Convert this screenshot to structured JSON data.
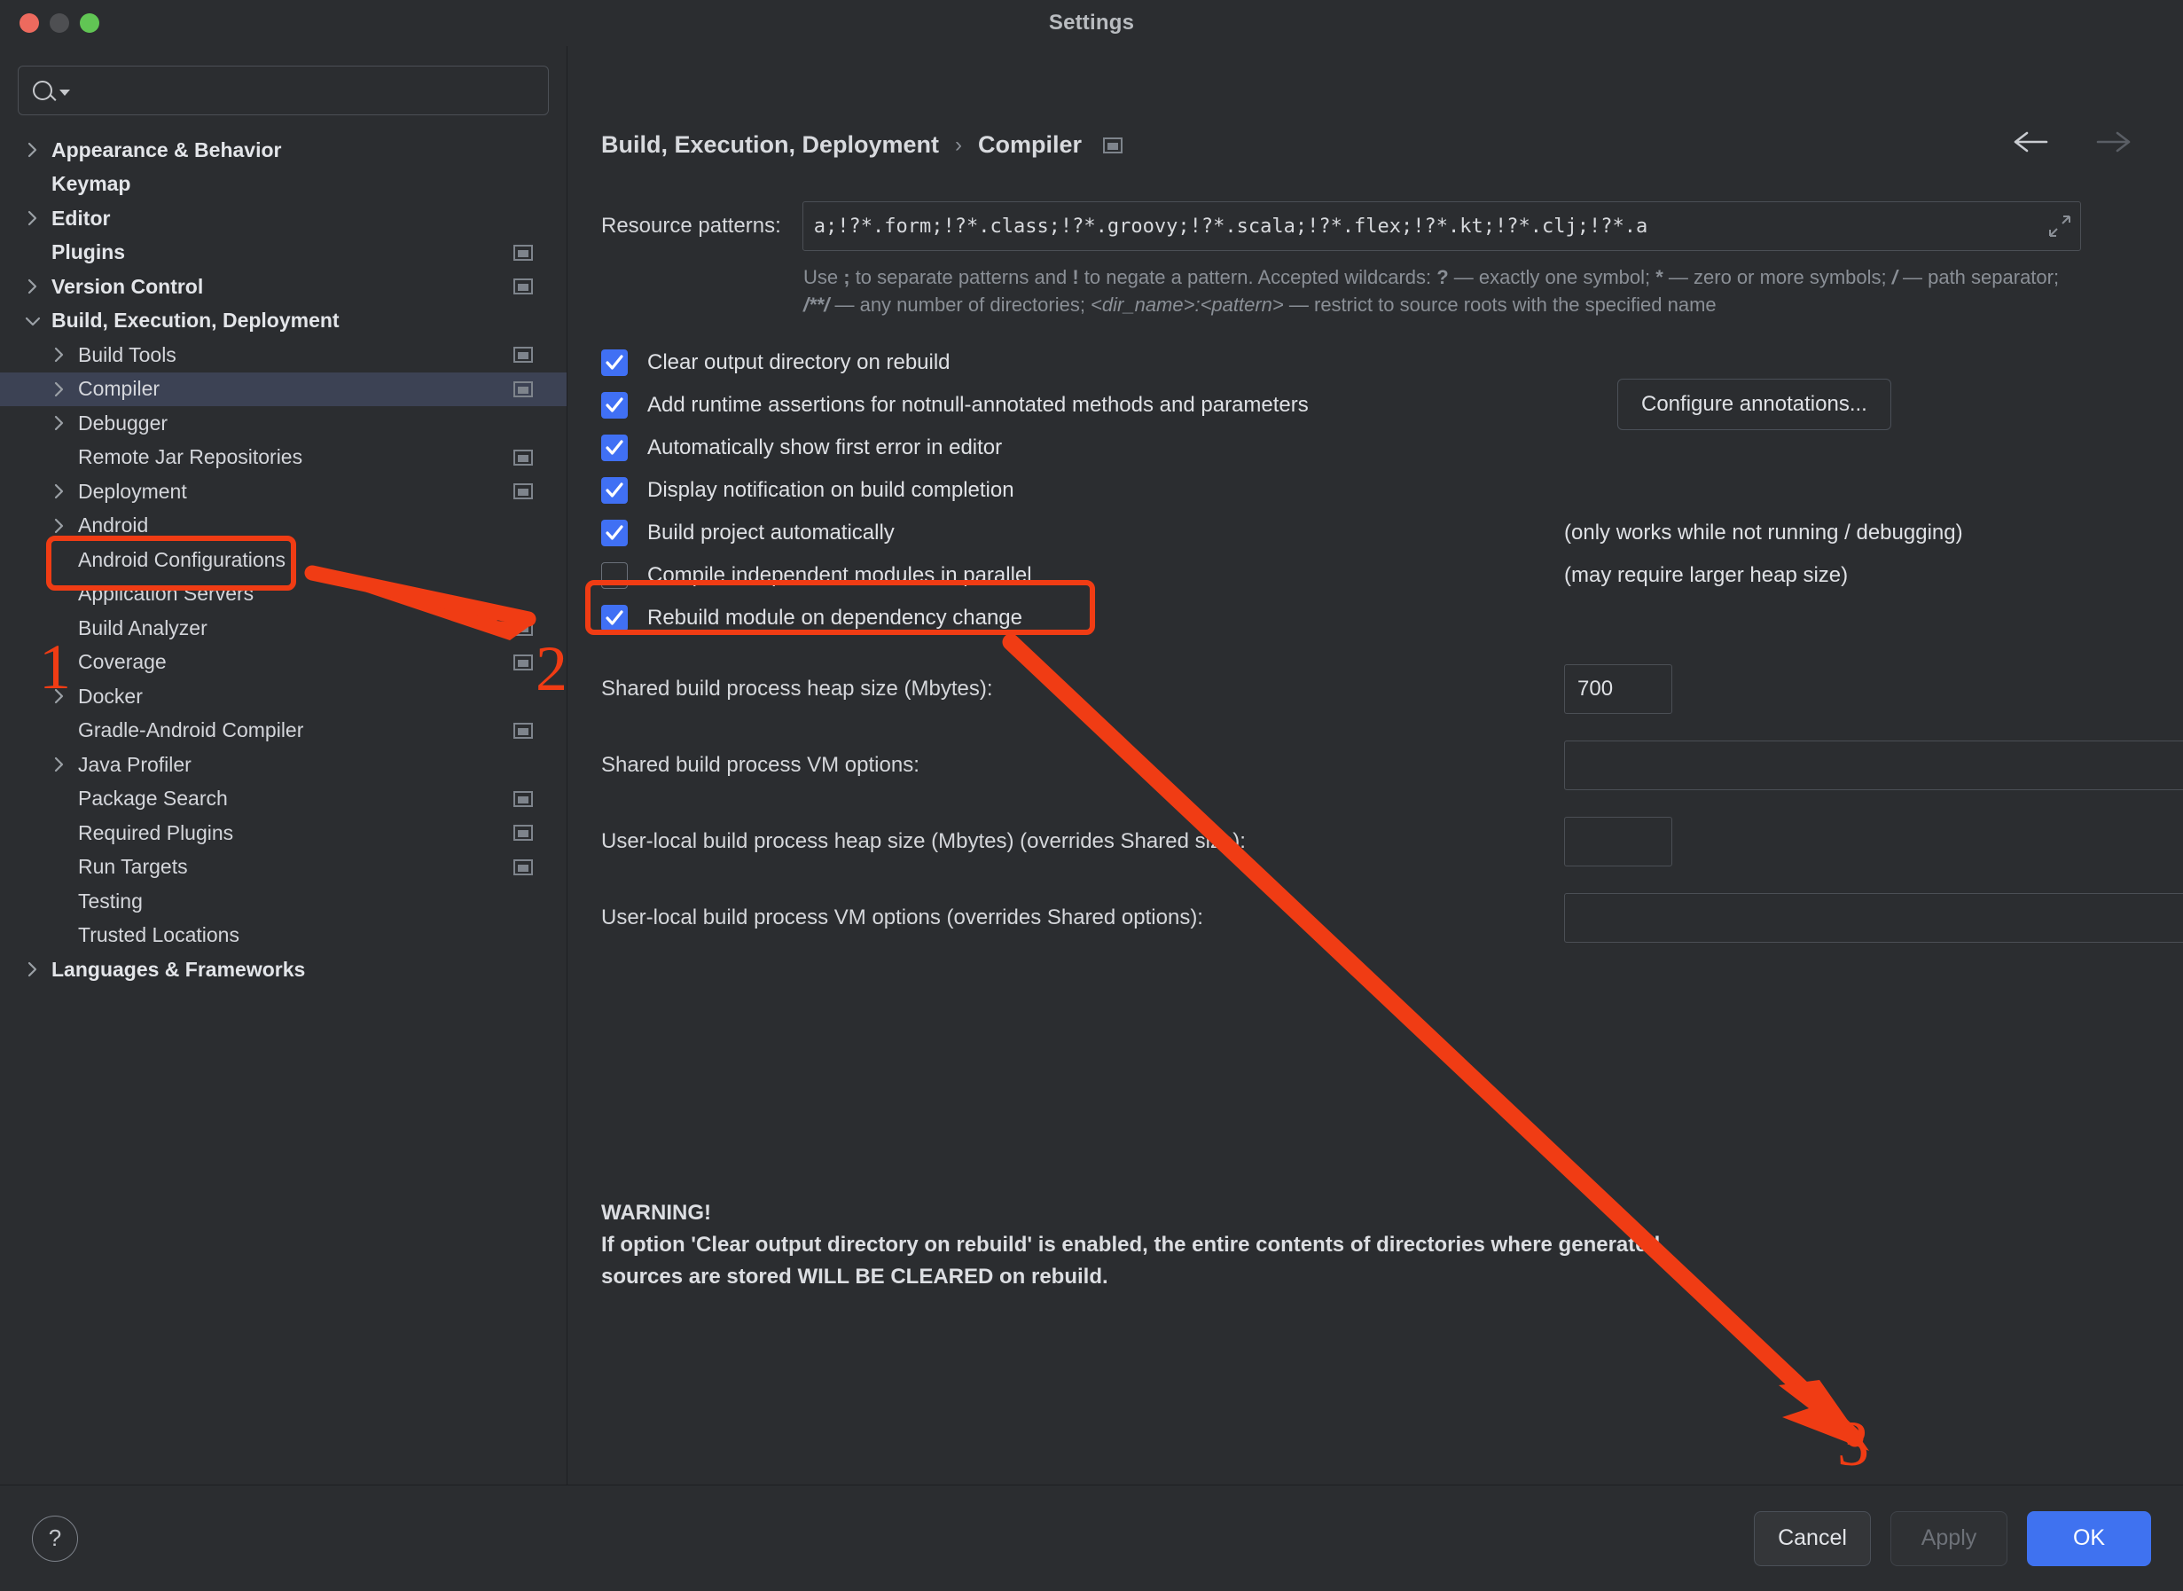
{
  "window": {
    "title": "Settings",
    "traffic_lights": [
      "close",
      "minimize",
      "zoom"
    ]
  },
  "sidebar": {
    "search": {
      "value": "",
      "placeholder": ""
    },
    "items": [
      {
        "label": "Appearance & Behavior",
        "indent": 0,
        "arrow": "right",
        "bold": true,
        "project_icon": false,
        "selected": false
      },
      {
        "label": "Keymap",
        "indent": 0,
        "arrow": "none",
        "bold": true,
        "project_icon": false,
        "selected": false
      },
      {
        "label": "Editor",
        "indent": 0,
        "arrow": "right",
        "bold": true,
        "project_icon": false,
        "selected": false
      },
      {
        "label": "Plugins",
        "indent": 0,
        "arrow": "none",
        "bold": true,
        "project_icon": true,
        "selected": false
      },
      {
        "label": "Version Control",
        "indent": 0,
        "arrow": "right",
        "bold": true,
        "project_icon": true,
        "selected": false
      },
      {
        "label": "Build, Execution, Deployment",
        "indent": 0,
        "arrow": "down",
        "bold": true,
        "project_icon": false,
        "selected": false
      },
      {
        "label": "Build Tools",
        "indent": 1,
        "arrow": "right",
        "bold": false,
        "project_icon": true,
        "selected": false
      },
      {
        "label": "Compiler",
        "indent": 1,
        "arrow": "right",
        "bold": false,
        "project_icon": true,
        "selected": true
      },
      {
        "label": "Debugger",
        "indent": 1,
        "arrow": "right",
        "bold": false,
        "project_icon": false,
        "selected": false
      },
      {
        "label": "Remote Jar Repositories",
        "indent": 1,
        "arrow": "none",
        "bold": false,
        "project_icon": true,
        "selected": false
      },
      {
        "label": "Deployment",
        "indent": 1,
        "arrow": "right",
        "bold": false,
        "project_icon": true,
        "selected": false
      },
      {
        "label": "Android",
        "indent": 1,
        "arrow": "right",
        "bold": false,
        "project_icon": false,
        "selected": false
      },
      {
        "label": "Android Configurations",
        "indent": 1,
        "arrow": "none",
        "bold": false,
        "project_icon": false,
        "selected": false
      },
      {
        "label": "Application Servers",
        "indent": 1,
        "arrow": "none",
        "bold": false,
        "project_icon": false,
        "selected": false
      },
      {
        "label": "Build Analyzer",
        "indent": 1,
        "arrow": "none",
        "bold": false,
        "project_icon": true,
        "selected": false
      },
      {
        "label": "Coverage",
        "indent": 1,
        "arrow": "none",
        "bold": false,
        "project_icon": true,
        "selected": false
      },
      {
        "label": "Docker",
        "indent": 1,
        "arrow": "right",
        "bold": false,
        "project_icon": false,
        "selected": false
      },
      {
        "label": "Gradle-Android Compiler",
        "indent": 1,
        "arrow": "none",
        "bold": false,
        "project_icon": true,
        "selected": false
      },
      {
        "label": "Java Profiler",
        "indent": 1,
        "arrow": "right",
        "bold": false,
        "project_icon": false,
        "selected": false
      },
      {
        "label": "Package Search",
        "indent": 1,
        "arrow": "none",
        "bold": false,
        "project_icon": true,
        "selected": false
      },
      {
        "label": "Required Plugins",
        "indent": 1,
        "arrow": "none",
        "bold": false,
        "project_icon": true,
        "selected": false
      },
      {
        "label": "Run Targets",
        "indent": 1,
        "arrow": "none",
        "bold": false,
        "project_icon": true,
        "selected": false
      },
      {
        "label": "Testing",
        "indent": 1,
        "arrow": "none",
        "bold": false,
        "project_icon": false,
        "selected": false
      },
      {
        "label": "Trusted Locations",
        "indent": 1,
        "arrow": "none",
        "bold": false,
        "project_icon": false,
        "selected": false
      },
      {
        "label": "Languages & Frameworks",
        "indent": 0,
        "arrow": "right",
        "bold": true,
        "project_icon": false,
        "selected": false
      }
    ]
  },
  "main": {
    "breadcrumb": {
      "parent": "Build, Execution, Deployment",
      "separator": "›",
      "current": "Compiler"
    },
    "nav": {
      "back": "back-arrow",
      "forward": "forward-arrow"
    },
    "resource_patterns": {
      "label": "Resource patterns:",
      "value": "a;!?*.form;!?*.class;!?*.groovy;!?*.scala;!?*.flex;!?*.kt;!?*.clj;!?*.a",
      "hint_line1_a": "Use ",
      "hint_semicolon": ";",
      "hint_line1_b": " to separate patterns and ",
      "hint_bang": "!",
      "hint_line1_c": " to negate a pattern. Accepted wildcards: ",
      "hint_q": "?",
      "hint_line1_d": " — exactly one symbol; ",
      "hint_star": "*",
      "hint_line1_e": " — zero or more symbols; ",
      "hint_slash": "/",
      "hint_line2_a": " — path separator; ",
      "hint_globstar": "/**/",
      "hint_line2_b": " — any number of directories; ",
      "hint_dirname": "<dir_name>:<pattern>",
      "hint_line2_c": " — restrict to source roots with the specified name"
    },
    "checkboxes": [
      {
        "label": "Clear output directory on rebuild",
        "checked": true,
        "mnemonic_index": 1
      },
      {
        "label": "Add runtime assertions for notnull-annotated methods and parameters",
        "checked": true,
        "mnemonic_index": 16
      },
      {
        "label": "Automatically show first error in editor",
        "checked": true,
        "mnemonic_index": 28
      },
      {
        "label": "Display notification on build completion",
        "checked": true,
        "mnemonic_index": -1
      },
      {
        "label": "Build project automatically",
        "checked": true,
        "mnemonic_index": -1
      },
      {
        "label": "Compile independent modules in parallel",
        "checked": false,
        "mnemonic_index": -1
      },
      {
        "label": "Rebuild module on dependency change",
        "checked": true,
        "mnemonic_index": 2
      }
    ],
    "configure_annotations_button": "Configure annotations...",
    "note_auto_build": "(only works while not running / debugging)",
    "note_parallel": "(may require larger heap size)",
    "fields": [
      {
        "label": "Shared build process heap size (Mbytes):",
        "value": "700",
        "size": "small",
        "expandable": false
      },
      {
        "label": "Shared build process VM options:",
        "value": "",
        "size": "wide",
        "expandable": true
      },
      {
        "label": "User-local build process heap size (Mbytes) (overrides Shared size):",
        "value": "",
        "size": "small",
        "expandable": false
      },
      {
        "label": "User-local build process VM options (overrides Shared options):",
        "value": "",
        "size": "wide",
        "expandable": true
      }
    ],
    "warning": {
      "title": "WARNING!",
      "line1": "If option 'Clear output directory on rebuild' is enabled, the entire contents of directories where generated",
      "line2": "sources are stored WILL BE CLEARED on rebuild."
    }
  },
  "footer": {
    "help": "?",
    "cancel": "Cancel",
    "apply": "Apply",
    "ok": "OK"
  },
  "annotations": {
    "marker_1": "1",
    "marker_2": "2",
    "marker_3": "3",
    "color": "#f03c14"
  }
}
